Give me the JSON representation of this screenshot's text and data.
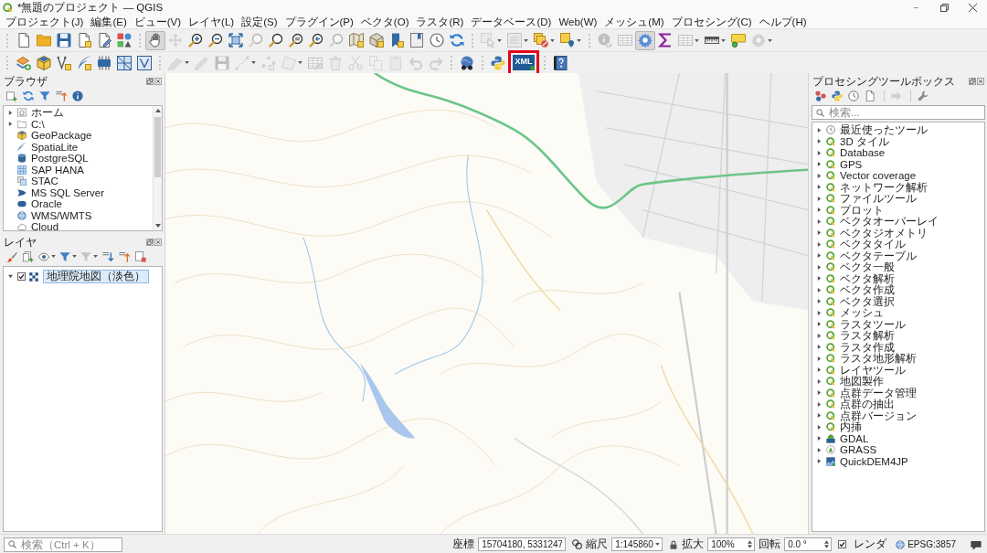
{
  "window": {
    "title": "*無題のプロジェクト — QGIS"
  },
  "menu_bar": [
    "プロジェクト(J)",
    "編集(E)",
    "ビュー(V)",
    "レイヤ(L)",
    "設定(S)",
    "プラグイン(P)",
    "ベクタ(O)",
    "ラスタ(R)",
    "データベース(D)",
    "Web(W)",
    "メッシュ(M)",
    "プロセシング(C)",
    "ヘルプ(H)"
  ],
  "toolbars": [
    {
      "buttons": [
        {
          "kind": "button",
          "disabled": false,
          "selected": false,
          "highlighted": false
        },
        {
          "kind": "button",
          "disabled": false,
          "selected": false,
          "highlighted": false
        },
        {
          "kind": "button",
          "disabled": false,
          "selected": false,
          "highlighted": false
        },
        {
          "kind": "button",
          "disabled": false,
          "selected": false,
          "highlighted": false
        },
        {
          "kind": "button",
          "disabled": false,
          "selected": false,
          "highlighted": false
        },
        {
          "kind": "button",
          "disabled": false,
          "selected": false,
          "highlighted": false
        },
        {
          "kind": "separator"
        },
        {
          "kind": "button",
          "disabled": false,
          "selected": true,
          "highlighted": false
        },
        {
          "kind": "button",
          "disabled": true,
          "selected": false,
          "highlighted": false
        },
        {
          "kind": "button",
          "disabled": false,
          "selected": false,
          "highlighted": false
        },
        {
          "kind": "button",
          "disabled": false,
          "selected": false,
          "highlighted": false
        },
        {
          "kind": "button",
          "disabled": false,
          "selected": false,
          "highlighted": false
        },
        {
          "kind": "button",
          "disabled": true,
          "selected": false,
          "highlighted": false
        },
        {
          "kind": "button",
          "disabled": false,
          "selected": false,
          "highlighted": false
        },
        {
          "kind": "button",
          "disabled": false,
          "selected": false,
          "highlighted": false
        },
        {
          "kind": "button",
          "disabled": false,
          "selected": false,
          "highlighted": false
        },
        {
          "kind": "button",
          "disabled": true,
          "selected": false,
          "highlighted": false
        },
        {
          "kind": "button",
          "disabled": false,
          "selected": false,
          "highlighted": false
        },
        {
          "kind": "button",
          "disabled": false,
          "selected": false,
          "highlighted": false
        },
        {
          "kind": "button",
          "disabled": false,
          "selected": false,
          "highlighted": false
        },
        {
          "kind": "button",
          "disabled": false,
          "selected": false,
          "highlighted": false
        },
        {
          "kind": "button",
          "disabled": false,
          "selected": false,
          "highlighted": false
        },
        {
          "kind": "button",
          "disabled": false,
          "selected": false,
          "highlighted": false
        },
        {
          "kind": "separator"
        },
        {
          "kind": "menu",
          "disabled": true,
          "selected": false,
          "highlighted": false
        },
        {
          "kind": "menu",
          "disabled": true,
          "selected": false,
          "highlighted": false
        },
        {
          "kind": "menu",
          "disabled": false,
          "selected": false,
          "highlighted": false
        },
        {
          "kind": "menu",
          "disabled": false,
          "selected": false,
          "highlighted": false
        },
        {
          "kind": "separator"
        },
        {
          "kind": "button",
          "disabled": true,
          "selected": false,
          "highlighted": false
        },
        {
          "kind": "button",
          "disabled": true,
          "selected": false,
          "highlighted": false
        },
        {
          "kind": "button",
          "disabled": false,
          "selected": true,
          "highlighted": false
        },
        {
          "kind": "button",
          "disabled": false,
          "selected": false,
          "highlighted": false
        },
        {
          "kind": "menu",
          "disabled": true,
          "selected": false,
          "highlighted": false
        },
        {
          "kind": "menu",
          "disabled": false,
          "selected": false,
          "highlighted": false
        },
        {
          "kind": "button",
          "disabled": false,
          "selected": false,
          "highlighted": false
        },
        {
          "kind": "menu",
          "disabled": true,
          "selected": false,
          "highlighted": false
        }
      ]
    },
    {
      "buttons": [
        {
          "kind": "button",
          "disabled": false,
          "selected": false,
          "highlighted": false
        },
        {
          "kind": "button",
          "disabled": false,
          "selected": false,
          "highlighted": false
        },
        {
          "kind": "button",
          "disabled": false,
          "selected": false,
          "highlighted": false
        },
        {
          "kind": "button",
          "disabled": false,
          "selected": false,
          "highlighted": false
        },
        {
          "kind": "button",
          "disabled": false,
          "selected": false,
          "highlighted": false
        },
        {
          "kind": "button",
          "disabled": false,
          "selected": false,
          "highlighted": false
        },
        {
          "kind": "button",
          "disabled": false,
          "selected": false,
          "highlighted": false
        },
        {
          "kind": "separator"
        },
        {
          "kind": "menu",
          "disabled": true,
          "selected": false,
          "highlighted": false
        },
        {
          "kind": "button",
          "disabled": true,
          "selected": false,
          "highlighted": false
        },
        {
          "kind": "button",
          "disabled": true,
          "selected": false,
          "highlighted": false
        },
        {
          "kind": "menu",
          "disabled": true,
          "selected": false,
          "highlighted": false
        },
        {
          "kind": "button",
          "disabled": true,
          "selected": false,
          "highlighted": false
        },
        {
          "kind": "menu",
          "disabled": true,
          "selected": false,
          "highlighted": false
        },
        {
          "kind": "button",
          "disabled": true,
          "selected": false,
          "highlighted": false
        },
        {
          "kind": "button",
          "disabled": true,
          "selected": false,
          "highlighted": false
        },
        {
          "kind": "button",
          "disabled": true,
          "selected": false,
          "highlighted": false
        },
        {
          "kind": "button",
          "disabled": true,
          "selected": false,
          "highlighted": false
        },
        {
          "kind": "button",
          "disabled": true,
          "selected": false,
          "highlighted": false
        },
        {
          "kind": "button",
          "disabled": true,
          "selected": false,
          "highlighted": false
        },
        {
          "kind": "button",
          "disabled": true,
          "selected": false,
          "highlighted": false
        },
        {
          "kind": "separator"
        },
        {
          "kind": "button",
          "disabled": false,
          "selected": false,
          "highlighted": false
        },
        {
          "kind": "separator"
        },
        {
          "kind": "button",
          "disabled": false,
          "selected": false,
          "highlighted": false
        },
        {
          "kind": "button",
          "label": "XML",
          "disabled": false,
          "selected": false,
          "highlighted": true
        },
        {
          "kind": "separator"
        },
        {
          "kind": "button",
          "disabled": false,
          "selected": false,
          "highlighted": false
        }
      ]
    }
  ],
  "browser": {
    "title": "ブラウザ",
    "toolbar": [
      {
        "kind": "button",
        "disabled": false
      },
      {
        "kind": "button",
        "disabled": false
      },
      {
        "kind": "button",
        "disabled": false
      },
      {
        "kind": "button",
        "disabled": false
      },
      {
        "kind": "button",
        "disabled": false
      }
    ],
    "items": [
      {
        "label": "ホーム",
        "kind": "folder",
        "expanded": false
      },
      {
        "label": "C:\\",
        "kind": "folder",
        "expanded": false
      },
      {
        "label": "GeoPackage",
        "kind": "source"
      },
      {
        "label": "SpatiaLite",
        "kind": "source"
      },
      {
        "label": "PostgreSQL",
        "kind": "source"
      },
      {
        "label": "SAP HANA",
        "kind": "source"
      },
      {
        "label": "STAC",
        "kind": "source"
      },
      {
        "label": "MS SQL Server",
        "kind": "source"
      },
      {
        "label": "Oracle",
        "kind": "source"
      },
      {
        "label": "WMS/WMTS",
        "kind": "source"
      },
      {
        "label": "Cloud",
        "kind": "source"
      }
    ]
  },
  "layers": {
    "title": "レイヤ",
    "toolbar": [
      {
        "kind": "button",
        "disabled": false
      },
      {
        "kind": "button",
        "disabled": false
      },
      {
        "kind": "menu",
        "disabled": false
      },
      {
        "kind": "menu",
        "disabled": false
      },
      {
        "kind": "menu",
        "disabled": true
      },
      {
        "kind": "button",
        "disabled": false
      },
      {
        "kind": "button",
        "disabled": false
      },
      {
        "kind": "button",
        "disabled": false
      }
    ],
    "items": [
      {
        "label": "地理院地図（淡色）",
        "expanded": true,
        "checked": true,
        "selected": true
      }
    ]
  },
  "processing": {
    "title": "プロセシングツールボックス",
    "toolbar": [
      {
        "kind": "button",
        "disabled": false
      },
      {
        "kind": "button",
        "disabled": false
      },
      {
        "kind": "button",
        "disabled": false
      },
      {
        "kind": "button",
        "disabled": false
      },
      {
        "kind": "separator"
      },
      {
        "kind": "button",
        "disabled": true
      },
      {
        "kind": "separator"
      },
      {
        "kind": "button",
        "disabled": false
      }
    ],
    "search": {
      "placeholder": "検索..."
    },
    "items": [
      {
        "label": "最近使ったツール",
        "expanded": false
      },
      {
        "label": "3D タイル",
        "expanded": false
      },
      {
        "label": "Database",
        "expanded": false
      },
      {
        "label": "GPS",
        "expanded": false
      },
      {
        "label": "Vector coverage",
        "expanded": false
      },
      {
        "label": "ネットワーク解析",
        "expanded": false
      },
      {
        "label": "ファイルツール",
        "expanded": false
      },
      {
        "label": "プロット",
        "expanded": false
      },
      {
        "label": "ベクタオーバーレイ",
        "expanded": false
      },
      {
        "label": "ベクタジオメトリ",
        "expanded": false
      },
      {
        "label": "ベクタタイル",
        "expanded": false
      },
      {
        "label": "ベクタテーブル",
        "expanded": false
      },
      {
        "label": "ベクタ一般",
        "expanded": false
      },
      {
        "label": "ベクタ解析",
        "expanded": false
      },
      {
        "label": "ベクタ作成",
        "expanded": false
      },
      {
        "label": "ベクタ選択",
        "expanded": false
      },
      {
        "label": "メッシュ",
        "expanded": false
      },
      {
        "label": "ラスタツール",
        "expanded": false
      },
      {
        "label": "ラスタ解析",
        "expanded": false
      },
      {
        "label": "ラスタ作成",
        "expanded": false
      },
      {
        "label": "ラスタ地形解析",
        "expanded": false
      },
      {
        "label": "レイヤツール",
        "expanded": false
      },
      {
        "label": "地図製作",
        "expanded": false
      },
      {
        "label": "点群データ管理",
        "expanded": false
      },
      {
        "label": "点群の抽出",
        "expanded": false
      },
      {
        "label": "点群バージョン",
        "expanded": false
      },
      {
        "label": "内挿",
        "expanded": false
      },
      {
        "label": "GDAL",
        "expanded": false
      },
      {
        "label": "GRASS",
        "expanded": false
      },
      {
        "label": "QuickDEM4JP",
        "expanded": false
      }
    ]
  },
  "status_bar": {
    "search": {
      "placeholder": "検索（Ctrl + K）"
    },
    "coordinate_label": "座標",
    "coordinate": "15704180, 5331247",
    "scale_label": "縮尺",
    "scale": "1:145860",
    "magnifier_label": "拡大",
    "magnifier": "100%",
    "rotation_label": "回転",
    "rotation": "0.0 °",
    "render": {
      "label": "レンダ",
      "checked": true
    },
    "crs": "EPSG:3857"
  }
}
